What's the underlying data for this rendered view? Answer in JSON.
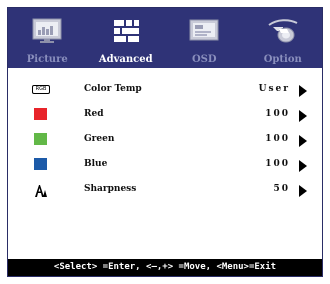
{
  "tabs": [
    {
      "label": "Picture",
      "icon": "picture-monitor-icon",
      "active": false
    },
    {
      "label": "Advanced",
      "icon": "advanced-grid-icon",
      "active": true
    },
    {
      "label": "OSD",
      "icon": "osd-window-icon",
      "active": false
    },
    {
      "label": "Option",
      "icon": "option-hand-icon",
      "active": false
    }
  ],
  "rows": [
    {
      "label": "Color Temp",
      "value": "User",
      "icon": "rgb-icon"
    },
    {
      "label": "Red",
      "value": "100",
      "icon": "red-swatch-icon",
      "color": "#e8242a"
    },
    {
      "label": "Green",
      "value": "100",
      "icon": "green-swatch-icon",
      "color": "#62b847"
    },
    {
      "label": "Blue",
      "value": "100",
      "icon": "blue-swatch-icon",
      "color": "#1c5aa8"
    },
    {
      "label": "Sharpness",
      "value": "50",
      "icon": "sharpness-icon"
    }
  ],
  "footer": "<Select> =Enter, <–,+> =Move, <Menu>=Exit",
  "colors": {
    "tabbar": "#2f3377",
    "footer": "#000000"
  }
}
